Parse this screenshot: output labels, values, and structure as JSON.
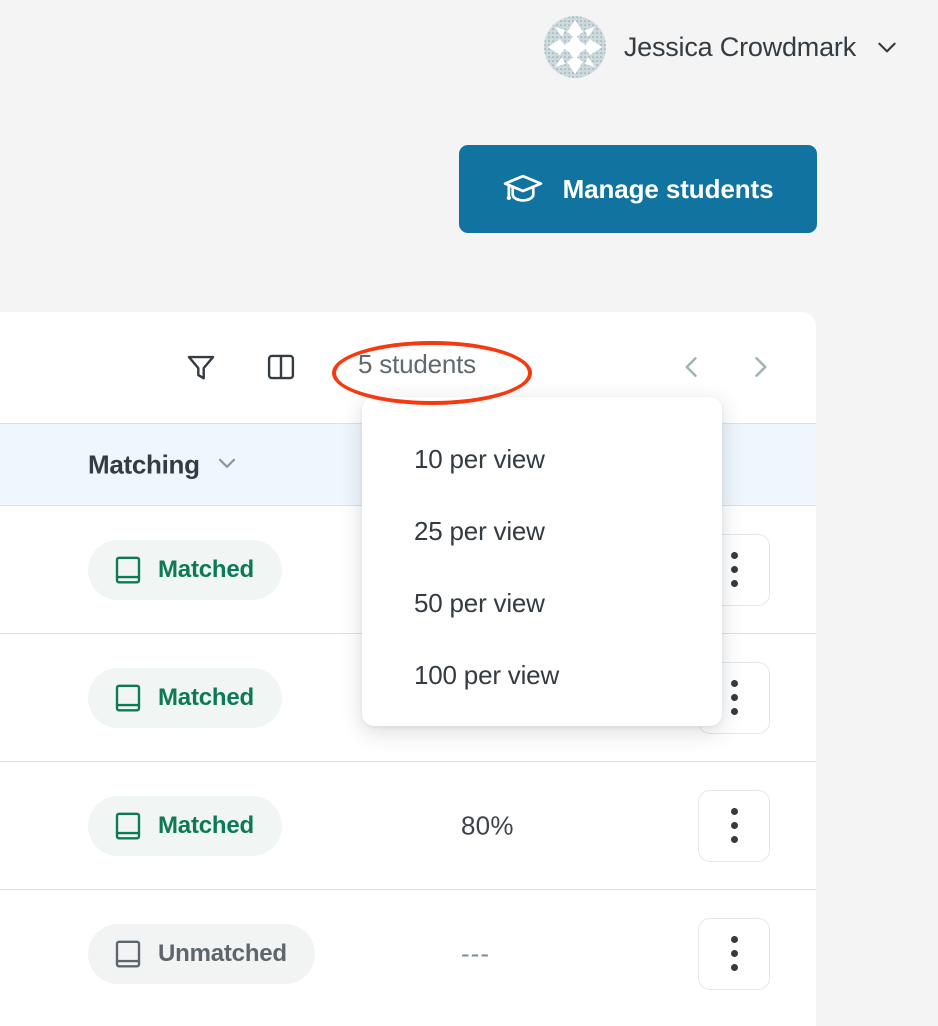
{
  "colors": {
    "page_background": "#f4f4f4",
    "primary_button": "#1073a0",
    "header_row": "#eff6fd",
    "matched_text": "#0c7a53",
    "unmatched_text": "#5d666d",
    "annotation": "#f6390f"
  },
  "topbar": {
    "avatar_icon": "user-avatar-identicon",
    "user_name": "Jessica Crowdmark",
    "caret_icon": "chevron-down-icon"
  },
  "actions": {
    "manage_students_label": "Manage students",
    "manage_students_icon": "graduation-cap-icon"
  },
  "toolbar": {
    "filter_icon": "filter-funnel-icon",
    "columns_icon": "columns-panel-icon",
    "per_view_label": "5 students",
    "prev_icon": "chevron-left-icon",
    "next_icon": "chevron-right-icon"
  },
  "per_view_menu": {
    "open": true,
    "options": [
      {
        "label": "10 per view"
      },
      {
        "label": "25 per view"
      },
      {
        "label": "50 per view"
      },
      {
        "label": "100 per view"
      }
    ]
  },
  "table": {
    "columns": [
      {
        "label": "Matching",
        "sort_icon": "chevron-down-icon"
      }
    ],
    "rows": [
      {
        "matching_status": "Matched",
        "status_icon": "book-icon",
        "score": ""
      },
      {
        "matching_status": "Matched",
        "status_icon": "book-icon",
        "score": ""
      },
      {
        "matching_status": "Matched",
        "status_icon": "book-icon",
        "score": "80%"
      },
      {
        "matching_status": "Unmatched",
        "status_icon": "book-icon",
        "score": "---"
      }
    ],
    "row_menu_icon": "kebab-menu-icon"
  }
}
